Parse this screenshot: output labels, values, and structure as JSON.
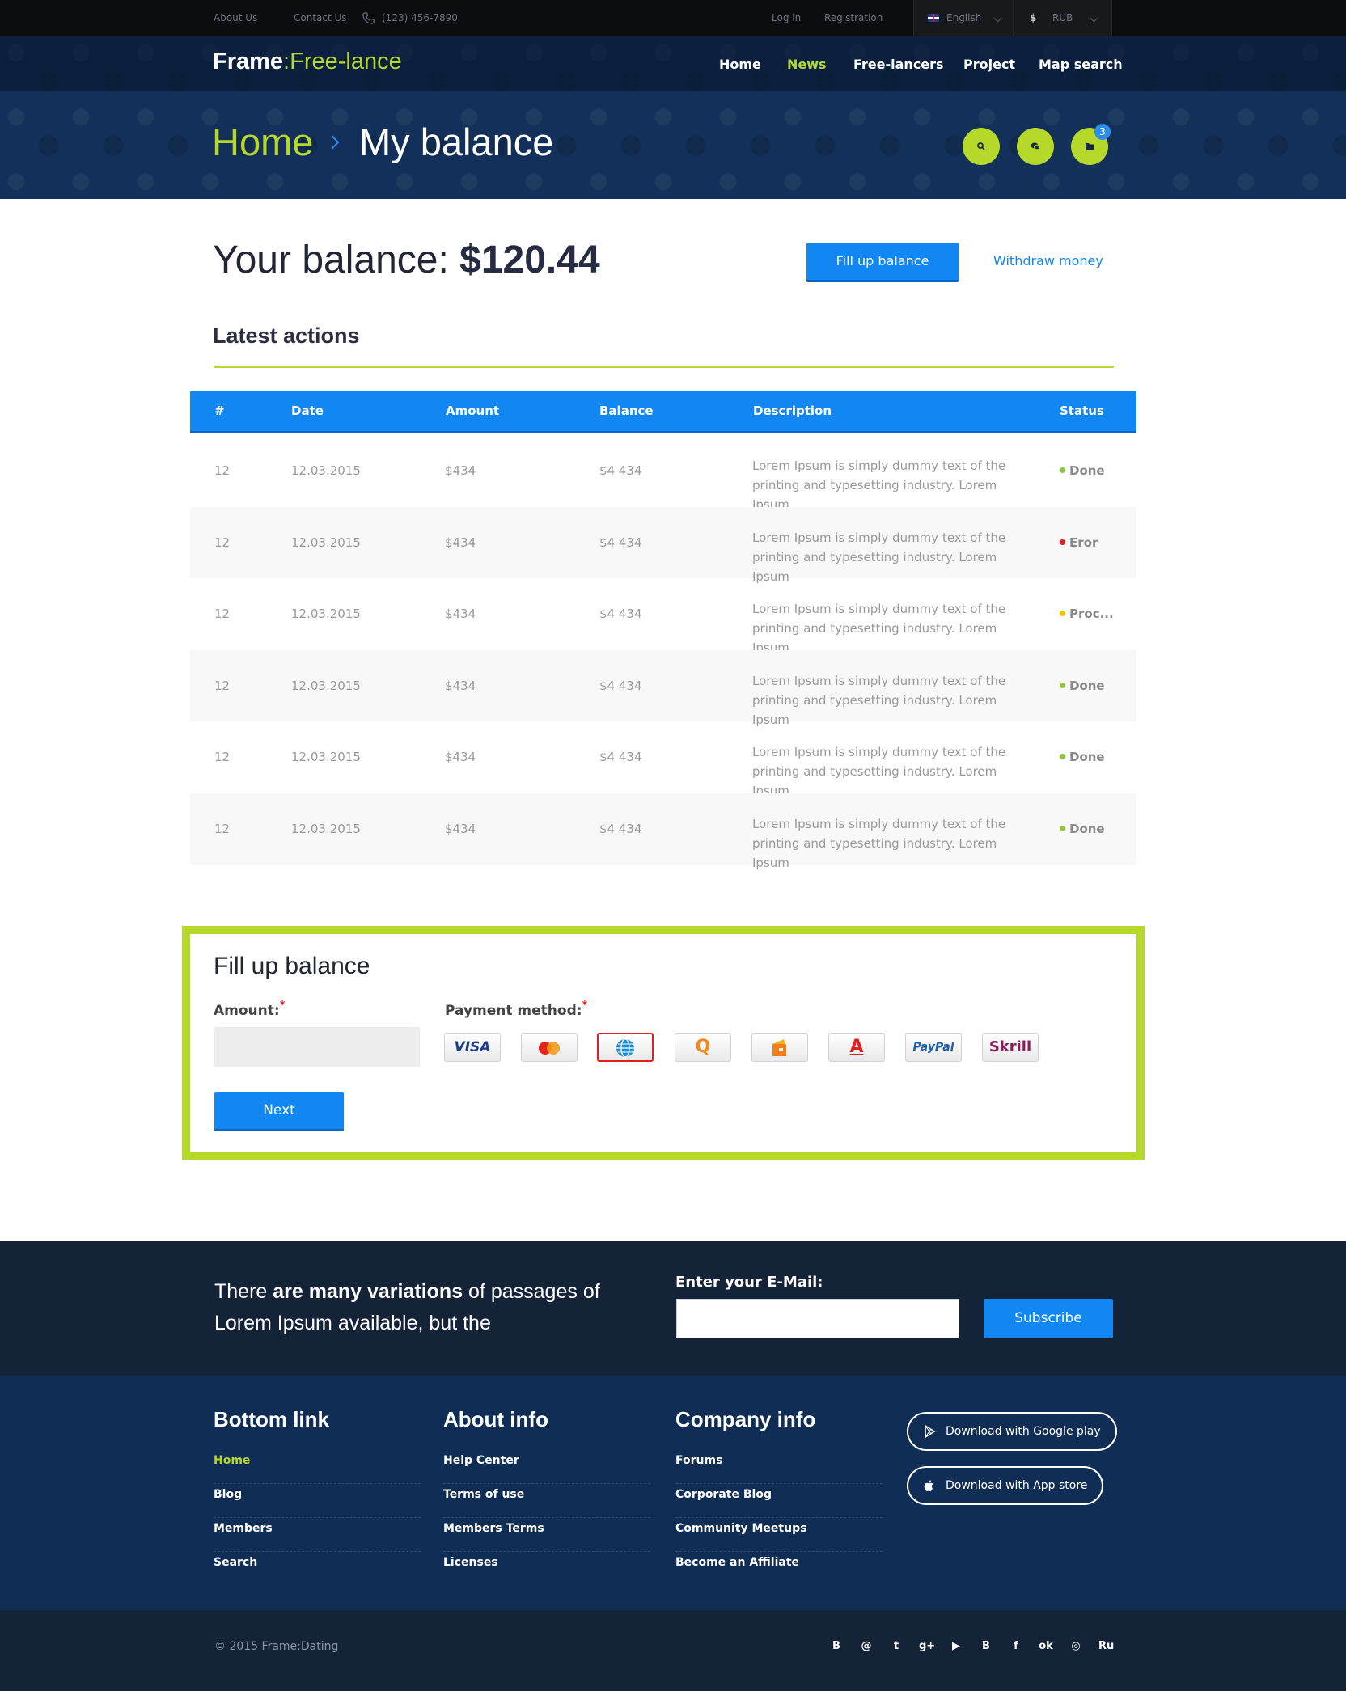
{
  "topbar": {
    "about": "About Us",
    "contact": "Contact Us",
    "phone": "(123) 456-7890",
    "login": "Log in",
    "registration": "Registration",
    "language": "English",
    "currency": "RUB",
    "currency_symbol": "$"
  },
  "header": {
    "logo_part1": "Frame",
    "logo_part2": ":Free-lance",
    "nav": [
      "Home",
      "News",
      "Free-lancers",
      "Project",
      "Map search"
    ],
    "active_nav": "News",
    "crumb_home": "Home",
    "crumb_current": "My balance",
    "folder_badge": "3",
    "accent": "#b5d82b"
  },
  "balance": {
    "label": "Your balance:",
    "amount": "$120.44",
    "fill_button": "Fill up balance",
    "withdraw_link": "Withdraw money"
  },
  "latest": {
    "title": "Latest actions",
    "columns": [
      "#",
      "Date",
      "Amount",
      "Balance",
      "Description",
      "Status"
    ],
    "rows": [
      {
        "num": "12",
        "date": "12.03.2015",
        "amount": "$434",
        "balance": "$4 434",
        "desc": "Lorem Ipsum is simply dummy text of the printing and typesetting industry. Lorem Ipsum",
        "status": "Done",
        "status_color": "#8cc63f"
      },
      {
        "num": "12",
        "date": "12.03.2015",
        "amount": "$434",
        "balance": "$4 434",
        "desc": "Lorem Ipsum is simply dummy text of the printing and typesetting industry. Lorem Ipsum",
        "status": "Eror",
        "status_color": "#e02020"
      },
      {
        "num": "12",
        "date": "12.03.2015",
        "amount": "$434",
        "balance": "$4 434",
        "desc": "Lorem Ipsum is simply dummy text of the printing and typesetting industry. Lorem Ipsum",
        "status": "Proc...",
        "status_color": "#f5c400"
      },
      {
        "num": "12",
        "date": "12.03.2015",
        "amount": "$434",
        "balance": "$4 434",
        "desc": "Lorem Ipsum is simply dummy text of the printing and typesetting industry. Lorem Ipsum",
        "status": "Done",
        "status_color": "#8cc63f"
      },
      {
        "num": "12",
        "date": "12.03.2015",
        "amount": "$434",
        "balance": "$4 434",
        "desc": "Lorem Ipsum is simply dummy text of the printing and typesetting industry. Lorem Ipsum",
        "status": "Done",
        "status_color": "#8cc63f"
      },
      {
        "num": "12",
        "date": "12.03.2015",
        "amount": "$434",
        "balance": "$4 434",
        "desc": "Lorem Ipsum is simply dummy text of the printing and typesetting industry. Lorem Ipsum",
        "status": "Done",
        "status_color": "#8cc63f"
      }
    ]
  },
  "fillup": {
    "title": "Fill up balance",
    "amount_label": "Amount:",
    "amount_value": "",
    "method_label": "Payment method:",
    "required_mark": "*",
    "methods": [
      "VISA",
      "MasterCard",
      "WebMoney",
      "QIWI",
      "Yandex.Money",
      "Alfa-Bank",
      "PayPal",
      "Skrill"
    ],
    "method_marks": [
      "VISA",
      "",
      "",
      "Q",
      "",
      "A",
      "PayPal",
      "Skrill"
    ],
    "selected_method": "WebMoney",
    "next_button": "Next"
  },
  "subscribe": {
    "text_pre": "There ",
    "text_bold": "are many variations",
    "text_post": " of passages of Lorem Ipsum available, but the",
    "email_label": "Enter your E-Mail:",
    "email_value": "",
    "button": "Subscribe"
  },
  "footer": {
    "col1": {
      "title": "Bottom link",
      "links": [
        "Home",
        "Blog",
        "Members",
        "Search"
      ]
    },
    "col2": {
      "title": "About info",
      "links": [
        "Help Center",
        "Terms of use",
        "Members Terms",
        "Licenses"
      ]
    },
    "col3": {
      "title": "Company info",
      "links": [
        "Forums",
        "Corporate Blog",
        "Community Meetups",
        "Become an Affiliate"
      ]
    },
    "google_play": "Download with Google play",
    "app_store": "Download with App store",
    "copyright": "© 2015 Frame:Dating",
    "social": [
      "vk-icon",
      "mail-icon",
      "tumblr-icon",
      "google-plus-icon",
      "youtube-icon",
      "blogger-icon",
      "facebook-icon",
      "odnoklassniki-icon",
      "dribbble-icon",
      "ru-icon"
    ],
    "social_glyphs": [
      "B",
      "@",
      "t",
      "g+",
      "▶",
      "B",
      "f",
      "ok",
      "◎",
      "Ru"
    ]
  }
}
